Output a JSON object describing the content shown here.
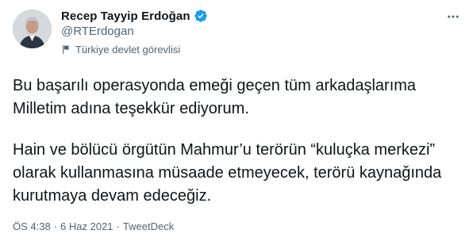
{
  "author": {
    "display_name": "Recep Tayyip Erdoğan",
    "handle": "@RTErdogan",
    "label": "Türkiye devlet görevlisi",
    "verified": true
  },
  "tweet": {
    "paragraphs": [
      "Bu başarılı operasyonda emeği geçen tüm arkadaşlarıma Milletim adına teşekkür ediyorum.",
      "Hain ve bölücü örgütün Mahmur’u terörün “kuluçka merkezi” olarak kullanmasına müsaade etmeyecek, terörü kaynağında kurutmaya devam edeceğiz."
    ],
    "time": "ÖS 4:38",
    "separator": "·",
    "date": "6 Haz 2021",
    "source": "TweetDeck"
  },
  "icons": {
    "verified_badge": "verified-badge-icon",
    "label": "flag-icon",
    "more": "more-icon"
  },
  "colors": {
    "text_primary": "#0f1419",
    "text_secondary": "#536471",
    "verified_blue": "#1d9bf0",
    "background": "#ffffff"
  }
}
